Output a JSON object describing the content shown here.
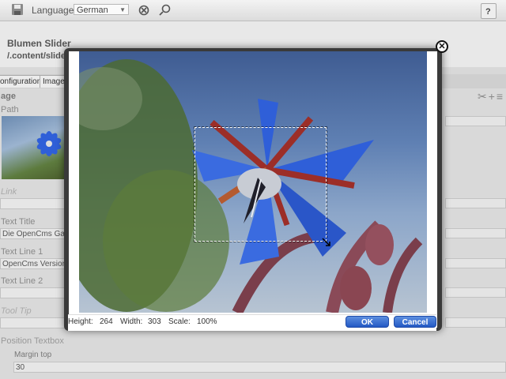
{
  "toolbar": {
    "language_label": "Language",
    "language_value": "German"
  },
  "editor": {
    "title": "Blumen Slider",
    "path": "/.content/slide"
  },
  "tabs": [
    {
      "label": "onfiguration"
    },
    {
      "label": "Image"
    }
  ],
  "form": {
    "image_heading": "age",
    "path_label": "Path",
    "link_label": "Link",
    "text_title_label": "Text Title",
    "text_title_value": "Die OpenCms Ga",
    "text_line1_label": "Text Line 1",
    "text_line1_value": "OpenCms Version",
    "text_line2_label": "Text Line 2",
    "tooltip_label": "Tool Tip",
    "position_label": "Position Textbox",
    "margin_top_label": "Margin top",
    "margin_top_value": "30"
  },
  "dialog": {
    "height_label": "Height:",
    "height_value": "264",
    "width_label": "Width:",
    "width_value": "303",
    "scale_label": "Scale:",
    "scale_value": "100%",
    "ok_label": "OK",
    "cancel_label": "Cancel"
  },
  "colors": {
    "button_blue": "#2459c4",
    "petal_blue": "#2f5fd8",
    "sky_blue": "#5f80b3"
  }
}
